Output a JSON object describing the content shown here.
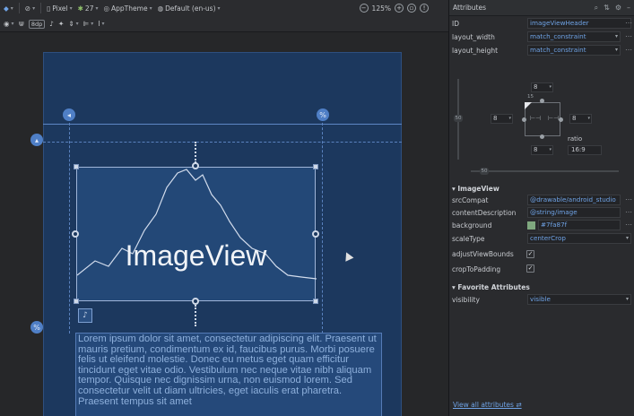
{
  "toolbar": {
    "device": "Pixel",
    "api": "27",
    "theme": "AppTheme",
    "locale": "Default (en-us)",
    "zoom": "125%",
    "margin_default": "8dp"
  },
  "canvas": {
    "imageview_label": "ImageView",
    "lorem_text": "Lorem ipsum dolor sit amet, consectetur adipiscing elit. Praesent ut mauris pretium, condimentum ex id, faucibus purus. Morbi posuere felis ut eleifend molestie. Donec eu metus eget quam efficitur tincidunt eget vitae odio. Vestibulum nec neque vitae nibh aliquam tempor. Quisque nec dignissim urna, non euismod lorem. Sed consectetur velit ut diam ultricies, eget iaculis erat pharetra. Praesent tempus sit amet"
  },
  "attributes": {
    "title": "Attributes",
    "id_label": "ID",
    "id_value": "imageViewHeader",
    "layout_width_label": "layout_width",
    "layout_width_value": "match_constraint",
    "layout_height_label": "layout_height",
    "layout_height_value": "match_constraint",
    "constraint_top": "8",
    "constraint_left": "8",
    "constraint_right": "8",
    "constraint_bottom": "8",
    "bias_top": "15",
    "bias_slider_left": "50",
    "bias_slider_bottom": "50",
    "ratio_label": "ratio",
    "ratio_value": "16:9",
    "section_imageview": "ImageView",
    "srccompat_label": "srcCompat",
    "srccompat_value": "@drawable/android_studio",
    "contentdesc_label": "contentDescription",
    "contentdesc_value": "@string/image",
    "background_label": "background",
    "background_value": "#7fa87f",
    "background_color": "#7fa87f",
    "scaletype_label": "scaleType",
    "scaletype_value": "centerCrop",
    "adjustviewbounds_label": "adjustViewBounds",
    "croptopadding_label": "cropToPadding",
    "section_favorite": "Favorite Attributes",
    "visibility_label": "visibility",
    "visibility_value": "visible",
    "view_all": "View all attributes"
  }
}
